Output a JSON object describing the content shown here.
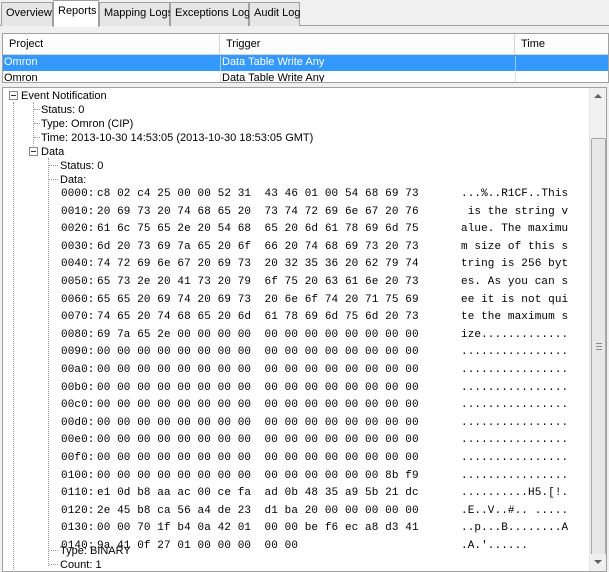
{
  "tabs": [
    {
      "label": "Overview",
      "active": false
    },
    {
      "label": "Reports",
      "active": true
    },
    {
      "label": "Mapping Logs",
      "active": false
    },
    {
      "label": "Exceptions Log",
      "active": false
    },
    {
      "label": "Audit Log",
      "active": false
    }
  ],
  "grid": {
    "columns": [
      "Project",
      "Trigger",
      "Time"
    ],
    "rows": [
      {
        "project": "Omron",
        "trigger": "Data Table Write Any",
        "time": "",
        "selected": true
      },
      {
        "project": "Omron",
        "trigger": "Data Table Write Any",
        "time": "",
        "selected": false
      }
    ]
  },
  "tree": {
    "event_label": "Event Notification",
    "status": "Status: 0",
    "type": "Type: Omron (CIP)",
    "time": "Time: 2013-10-30 14:53:05 (2013-10-30 18:53:05 GMT)",
    "data_label": "Data",
    "data_status": "Status: 0",
    "data_data": "Data:",
    "hex_rows": [
      {
        "addr": "0000:",
        "hex": "c8 02 c4 25 00 00 52 31  43 46 01 00 54 68 69 73",
        "ascii": "...%..R1CF..This"
      },
      {
        "addr": "0010:",
        "hex": "20 69 73 20 74 68 65 20  73 74 72 69 6e 67 20 76",
        "ascii": " is the string v"
      },
      {
        "addr": "0020:",
        "hex": "61 6c 75 65 2e 20 54 68  65 20 6d 61 78 69 6d 75",
        "ascii": "alue. The maximu"
      },
      {
        "addr": "0030:",
        "hex": "6d 20 73 69 7a 65 20 6f  66 20 74 68 69 73 20 73",
        "ascii": "m size of this s"
      },
      {
        "addr": "0040:",
        "hex": "74 72 69 6e 67 20 69 73  20 32 35 36 20 62 79 74",
        "ascii": "tring is 256 byt"
      },
      {
        "addr": "0050:",
        "hex": "65 73 2e 20 41 73 20 79  6f 75 20 63 61 6e 20 73",
        "ascii": "es. As you can s"
      },
      {
        "addr": "0060:",
        "hex": "65 65 20 69 74 20 69 73  20 6e 6f 74 20 71 75 69",
        "ascii": "ee it is not qui"
      },
      {
        "addr": "0070:",
        "hex": "74 65 20 74 68 65 20 6d  61 78 69 6d 75 6d 20 73",
        "ascii": "te the maximum s"
      },
      {
        "addr": "0080:",
        "hex": "69 7a 65 2e 00 00 00 00  00 00 00 00 00 00 00 00",
        "ascii": "ize............."
      },
      {
        "addr": "0090:",
        "hex": "00 00 00 00 00 00 00 00  00 00 00 00 00 00 00 00",
        "ascii": "................"
      },
      {
        "addr": "00a0:",
        "hex": "00 00 00 00 00 00 00 00  00 00 00 00 00 00 00 00",
        "ascii": "................"
      },
      {
        "addr": "00b0:",
        "hex": "00 00 00 00 00 00 00 00  00 00 00 00 00 00 00 00",
        "ascii": "................"
      },
      {
        "addr": "00c0:",
        "hex": "00 00 00 00 00 00 00 00  00 00 00 00 00 00 00 00",
        "ascii": "................"
      },
      {
        "addr": "00d0:",
        "hex": "00 00 00 00 00 00 00 00  00 00 00 00 00 00 00 00",
        "ascii": "................"
      },
      {
        "addr": "00e0:",
        "hex": "00 00 00 00 00 00 00 00  00 00 00 00 00 00 00 00",
        "ascii": "................"
      },
      {
        "addr": "00f0:",
        "hex": "00 00 00 00 00 00 00 00  00 00 00 00 00 00 00 00",
        "ascii": "................"
      },
      {
        "addr": "0100:",
        "hex": "00 00 00 00 00 00 00 00  00 00 00 00 00 00 8b f9",
        "ascii": "................"
      },
      {
        "addr": "0110:",
        "hex": "e1 0d b8 aa ac 00 ce fa  ad 0b 48 35 a9 5b 21 dc",
        "ascii": "..........H5.[!."
      },
      {
        "addr": "0120:",
        "hex": "2e 45 b8 ca 56 a4 de 23  d1 ba 20 00 00 00 00 00",
        "ascii": ".E..V..#.. ....."
      },
      {
        "addr": "0130:",
        "hex": "00 00 70 1f b4 0a 42 01  00 00 be f6 ec a8 d3 41",
        "ascii": "..p...B........A"
      },
      {
        "addr": "0140:",
        "hex": "9a 41 0f 27 01 00 00 00  00 00",
        "ascii": ".A.'......"
      }
    ],
    "data_type": "Type: BINARY",
    "data_count": "Count: 1"
  },
  "icons": {
    "expander": "minus-box-icon",
    "scroll_up": "arrow-up-icon",
    "scroll_down": "arrow-down-icon"
  }
}
